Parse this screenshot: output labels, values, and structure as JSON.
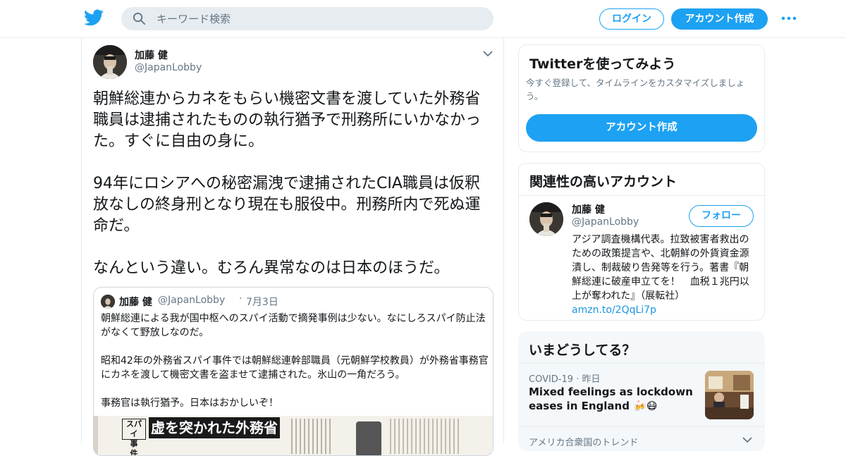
{
  "header": {
    "search_placeholder": "キーワード検索",
    "login_label": "ログイン",
    "signup_label": "アカウント作成"
  },
  "tweet": {
    "author_name": "加藤 健",
    "author_handle": "@JapanLobby",
    "text": "朝鮮総連からカネをもらい機密文書を渡していた外務省職員は逮捕されたものの執行猶予で刑務所にいかなかった。すぐに自由の身に。\n\n94年にロシアへの秘密漏洩で逮捕されたCIA職員は仮釈放なしの終身刑となり現在も服役中。刑務所内で死ぬ運命だ。\n\nなんという違い。むろん異常なのは日本のほうだ。",
    "quoted": {
      "author_name": "加藤 健",
      "author_handle": "@JapanLobby",
      "separator": "·",
      "date": "7月3日",
      "text": "朝鮮総連による我が国中枢へのスパイ活動で摘発事例は少ない。なにしろスパイ防止法がなくて野放しなのだ。\n\n昭和42年の外務省スパイ事件では朝鮮総連幹部職員（元朝鮮学校教員）が外務省事務官にカネを渡して機密文書を盗ませて逮捕された。氷山の一角だろう。\n\n事務官は執行猶予。日本はおかしいぞ！",
      "image_headline": "虚を突かれた外務省",
      "image_label_1": "スパイ",
      "image_label_2": "事　件"
    }
  },
  "sidebar": {
    "try_card": {
      "title": "Twitterを使ってみよう",
      "description": "今すぐ登録して、タイムラインをカスタマイズしましょう。",
      "button_label": "アカウント作成"
    },
    "related_card": {
      "title": "関連性の高いアカウント",
      "name": "加藤 健",
      "handle": "@JapanLobby",
      "follow_label": "フォロー",
      "bio": "アジア調査機構代表。拉致被害者救出のための政策提言や、北朝鮮の外貨資金源潰し、制裁破り告発等を行う。著書『朝鮮総連に破産申立てを！　血税１兆円以上が奪われた』（展転社）",
      "bio_link": "amzn.to/2QqLi7p"
    },
    "trends_card": {
      "title": "いまどうしてる？",
      "trend_meta": "COVID-19",
      "trend_dot": "·",
      "trend_time": "昨日",
      "trend_title": "Mixed feelings as lockdown eases in England 🍻😷",
      "location_label": "アメリカ合衆国のトレンド"
    }
  },
  "colors": {
    "accent": "#1da1f2",
    "muted": "#657786",
    "border": "#e6ecf0"
  }
}
